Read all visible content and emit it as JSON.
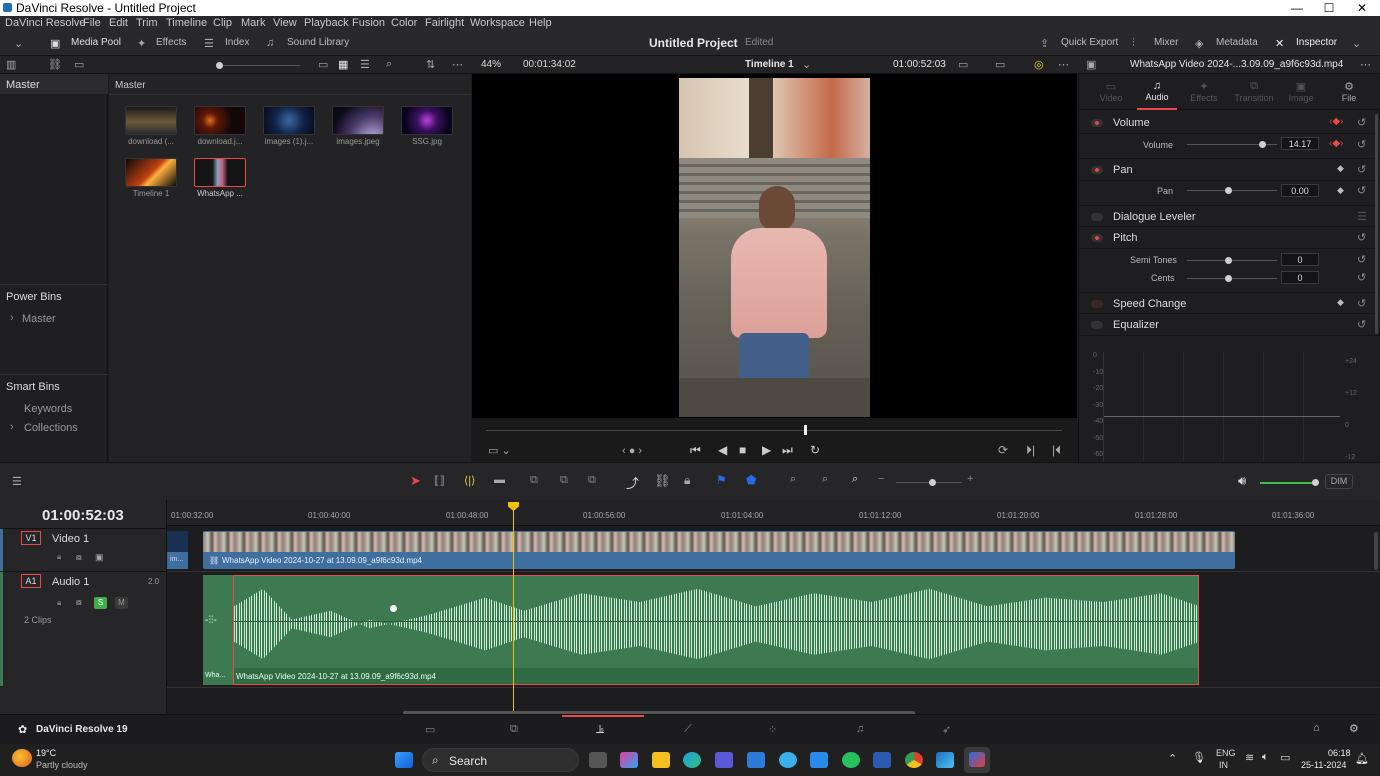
{
  "window": {
    "title": "DaVinci Resolve - Untitled Project"
  },
  "menu": [
    "DaVinci Resolve",
    "File",
    "Edit",
    "Trim",
    "Timeline",
    "Clip",
    "Mark",
    "View",
    "Playback",
    "Fusion",
    "Color",
    "Fairlight",
    "Workspace",
    "Help"
  ],
  "toolbar": {
    "media_pool": "Media Pool",
    "effects": "Effects",
    "index": "Index",
    "sound_library": "Sound Library",
    "project_title": "Untitled Project",
    "edited": "Edited",
    "quick_export": "Quick Export",
    "mixer": "Mixer",
    "metadata": "Metadata",
    "inspector": "Inspector"
  },
  "viewerbar": {
    "zoom": "44%",
    "duration": "00:01:34:02",
    "timeline": "Timeline 1",
    "timecode": "01:00:52:03",
    "clip_name": "WhatsApp Video 2024-...3.09.09_a9f6c93d.mp4"
  },
  "bins": {
    "master": "Master",
    "power_bins": "Power Bins",
    "power_master": "Master",
    "smart_bins": "Smart Bins",
    "keywords": "Keywords",
    "collections": "Collections"
  },
  "mediapool": {
    "header": "Master",
    "clips": [
      {
        "label": "download (...",
        "color": "#6b5a3a"
      },
      {
        "label": "download.j...",
        "color": "#2a1a10"
      },
      {
        "label": "images (1).j...",
        "color": "#1a3050"
      },
      {
        "label": "images.jpeg",
        "color": "#3a2a4a"
      },
      {
        "label": "SSG.jpg",
        "color": "#2a1050"
      },
      {
        "label": "Timeline 1",
        "color": "#5a2a10"
      },
      {
        "label": "WhatsApp ...",
        "color": "#3a4a5a"
      }
    ]
  },
  "inspector": {
    "tabs": [
      "Video",
      "Audio",
      "Effects",
      "Transition",
      "Image",
      "File"
    ],
    "volume_section": "Volume",
    "volume_label": "Volume",
    "volume_value": "14.17",
    "pan_section": "Pan",
    "pan_label": "Pan",
    "pan_value": "0.00",
    "dialogue": "Dialogue Leveler",
    "pitch_section": "Pitch",
    "semitones_label": "Semi Tones",
    "semitones_value": "0",
    "cents_label": "Cents",
    "cents_value": "0",
    "speed": "Speed Change",
    "equalizer": "Equalizer",
    "eq_left": [
      "0",
      "-10",
      "-20",
      "-30",
      "-40",
      "-50",
      "-60"
    ],
    "eq_right": [
      "+24",
      "+12",
      "0",
      "-12"
    ]
  },
  "timeline": {
    "timecode": "01:00:52:03",
    "ruler": [
      "01:00:32:00",
      "01:00:40:00",
      "01:00:48:00",
      "01:00:56:00",
      "01:01:04:00",
      "01:01:12:00",
      "01:01:20:00",
      "01:01:28:00",
      "01:01:36:00"
    ],
    "v1_id": "V1",
    "v1_name": "Video 1",
    "a1_id": "A1",
    "a1_name": "Audio 1",
    "a1_level": "2.0",
    "clip_count": "2 Clips",
    "video_clip": "WhatsApp Video 2024-10-27 at 13.09.09_a9f6c93d.mp4",
    "video_stub": "im...",
    "audio_clip": "WhatsApp Video 2024-10-27 at 13.09.09_a9f6c93d.mp4",
    "audio_stub": "Wha...",
    "s_btn": "S",
    "m_btn": "M",
    "dim": "DIM"
  },
  "footer": {
    "app_name": "DaVinci Resolve 19"
  },
  "taskbar": {
    "temp": "19°C",
    "weather": "Partly cloudy",
    "search": "Search",
    "lang1": "ENG",
    "lang2": "IN",
    "time": "06:18",
    "date": "25-11-2024"
  },
  "colors": {
    "accent": "#e84a4a",
    "audio_clip": "#3d7a52",
    "video_clip": "#3f6f9e",
    "playhead": "#f2c200"
  }
}
